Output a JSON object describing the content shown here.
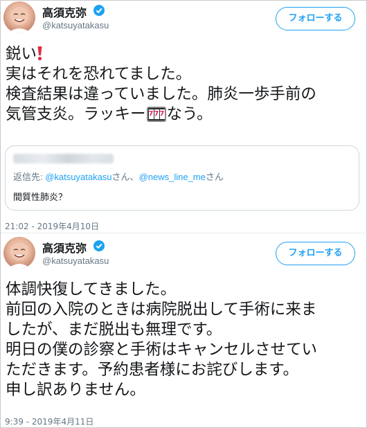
{
  "tweets": [
    {
      "author": {
        "name": "高須克弥",
        "handle": "@katsuyatakasu"
      },
      "follow_label": "フォローする",
      "lines": [
        "鋭い",
        "実はそれを恐れてました。",
        "検査結果は違っていました。肺炎一歩手前の",
        "気管支炎。ラッキー",
        "なう。"
      ],
      "quoted": {
        "reply_prefix": "返信先: ",
        "reply_user1": "@katsuyatakasu",
        "reply_mid": "さん、",
        "reply_user2": "@news_line_me",
        "reply_suffix": "さん",
        "text": "間質性肺炎？"
      },
      "timestamp": "21:02 - 2019年4月10日"
    },
    {
      "author": {
        "name": "高須克弥",
        "handle": "@katsuyatakasu"
      },
      "follow_label": "フォローする",
      "lines": [
        "体調快復してきました。",
        "前回の入院のときは病院脱出して手術に来ま",
        "したが、まだ脱出も無理です。",
        "明日の僕の診察と手術はキャンセルさせてい",
        "ただきます。予約患者様にお詫びします。",
        "申し訳ありません。"
      ],
      "timestamp": "9:39 - 2019年4月11日"
    }
  ],
  "icons": {
    "verified": "verified-badge-icon",
    "exclamation": "red-exclamation-icon",
    "slot": "slot-machine-icon"
  },
  "colors": {
    "accent": "#1da1f2",
    "text": "#14171a",
    "muted": "#657786",
    "exclamation": "#dd2e44"
  }
}
